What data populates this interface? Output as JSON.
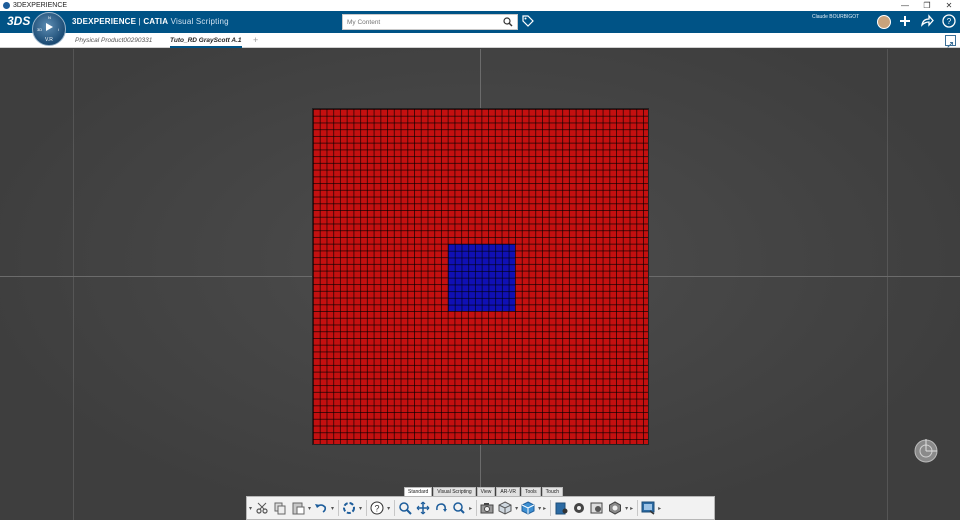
{
  "window": {
    "title": "3DEXPERIENCE"
  },
  "header": {
    "brand_bold": "3DEXPERIENCE",
    "brand_sep": " | ",
    "brand_app": "CATIA",
    "brand_role": " Visual Scripting",
    "compass_version": "V.R",
    "search_placeholder": "My Content",
    "user_name": "Claude BOURBIGOT"
  },
  "tabs": [
    {
      "label": "Physical Product00290331"
    },
    {
      "label": "Tuto_RD GrayScott A.1"
    }
  ],
  "tab_add": "+",
  "model": {
    "outer_color": "#c41010",
    "inner_color": "#1010b5",
    "grid_cells": 50,
    "inner_cells": 10
  },
  "action_bar": {
    "sections": [
      "Standard",
      "Visual Scripting",
      "View",
      "AR-VR",
      "Tools",
      "Touch"
    ],
    "active_section": "Standard",
    "icons": [
      "cut-icon",
      "copy-icon",
      "paste-icon",
      "undo-icon",
      "update-icon",
      "help-icon",
      "zoom-icon",
      "pan-icon",
      "rotate-icon",
      "fit-icon",
      "capture-icon",
      "cube-icon",
      "3d-view-icon",
      "layer-icon",
      "settings-icon",
      "render-icon",
      "options-icon",
      "display-icon"
    ]
  },
  "colors": {
    "header_blue": "#005386",
    "viewport_bg": "#3f3f3f"
  }
}
